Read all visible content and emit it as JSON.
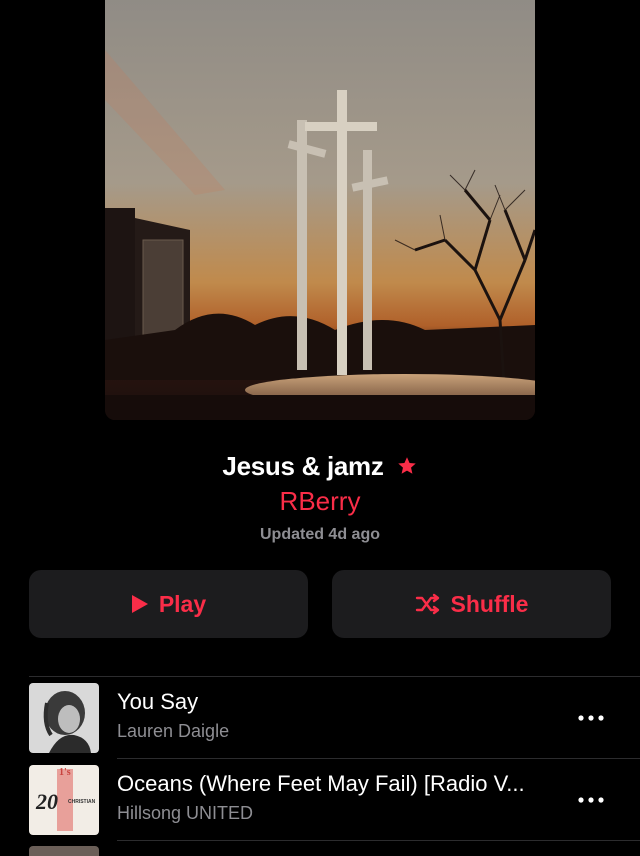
{
  "playlist": {
    "title": "Jesus & jamz",
    "curator": "RBerry",
    "updated": "Updated 4d ago",
    "accent_color": "#fa2d48"
  },
  "actions": {
    "play_label": "Play",
    "shuffle_label": "Shuffle",
    "play_icon": "play-icon",
    "shuffle_icon": "shuffle-icon"
  },
  "tracks": [
    {
      "title": "You Say",
      "artist": "Lauren Daigle"
    },
    {
      "title": "Oceans (Where Feet May Fail) [Radio V...",
      "artist": "Hillsong UNITED",
      "artwork_text": "20",
      "artwork_badge": "1's",
      "artwork_tag": "CHRISTIAN"
    }
  ]
}
